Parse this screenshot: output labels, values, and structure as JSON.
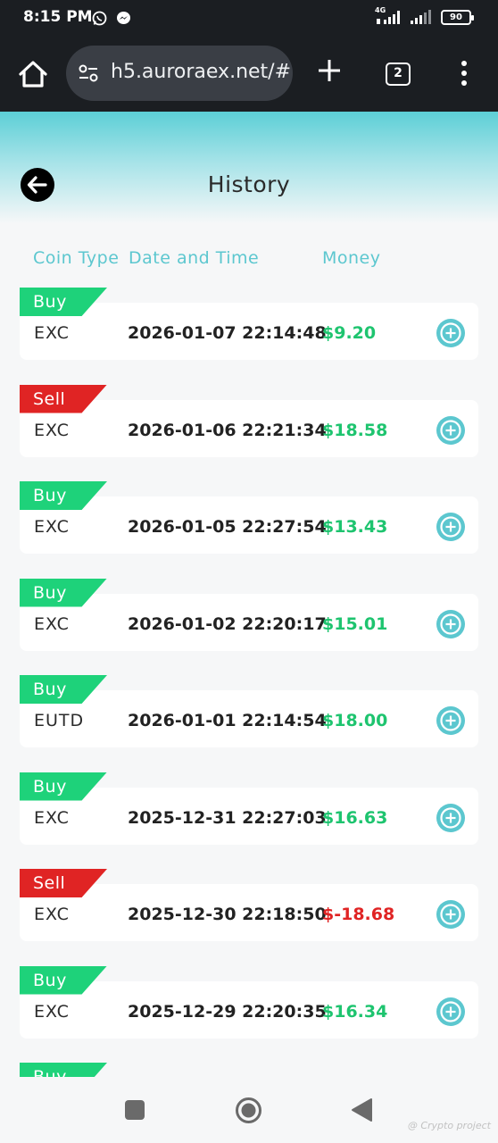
{
  "status_bar": {
    "time": "8:15 PM",
    "network": "4G",
    "battery": "90"
  },
  "browser": {
    "url": "h5.auroraex.net/#",
    "tab_count": "2"
  },
  "header": {
    "title": "History"
  },
  "columns": {
    "coin_type": "Coin Type",
    "date_time": "Date and Time",
    "money": "Money"
  },
  "rows": [
    {
      "type": "Buy",
      "coin": "EXC",
      "datetime": "2026-01-07 22:14:48",
      "money": "$9.20"
    },
    {
      "type": "Sell",
      "coin": "EXC",
      "datetime": "2026-01-06 22:21:34",
      "money": "$18.58"
    },
    {
      "type": "Buy",
      "coin": "EXC",
      "datetime": "2026-01-05 22:27:54",
      "money": "$13.43"
    },
    {
      "type": "Buy",
      "coin": "EXC",
      "datetime": "2026-01-02 22:20:17",
      "money": "$15.01"
    },
    {
      "type": "Buy",
      "coin": "EUTD",
      "datetime": "2026-01-01 22:14:54",
      "money": "$18.00"
    },
    {
      "type": "Buy",
      "coin": "EXC",
      "datetime": "2025-12-31 22:27:03",
      "money": "$16.63"
    },
    {
      "type": "Sell",
      "coin": "EXC",
      "datetime": "2025-12-30 22:18:50",
      "money": "$-18.68"
    },
    {
      "type": "Buy",
      "coin": "EXC",
      "datetime": "2025-12-29 22:20:35",
      "money": "$16.34"
    },
    {
      "type": "Buy",
      "coin": "",
      "datetime": "",
      "money": ""
    }
  ],
  "watermark": "@ Crypto project",
  "colors": {
    "accent": "#5cc7cf",
    "buy": "#1ed27a",
    "sell": "#e02424",
    "money_positive": "#1ec46f",
    "money_negative": "#e02424"
  }
}
